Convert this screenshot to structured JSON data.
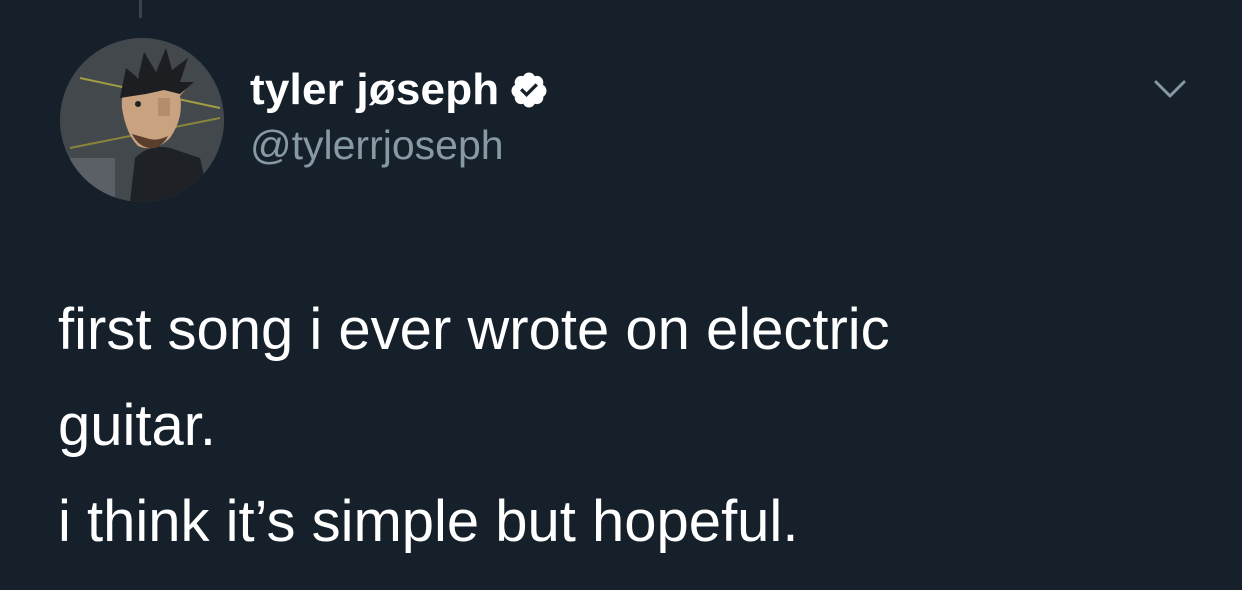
{
  "tweet": {
    "author": {
      "display_name": "tyler jøseph",
      "handle": "@tylerrjoseph",
      "verified": true,
      "avatar_icon": "avatar-illustration"
    },
    "menu_icon": "chevron-down-icon",
    "text_lines": [
      "first song i ever wrote on electric",
      "guitar.",
      "i think it’s simple but hopeful."
    ]
  },
  "colors": {
    "background": "#15202b",
    "primary_text": "#ffffff",
    "secondary_text": "#8899a6",
    "thread_line": "#38444d"
  }
}
